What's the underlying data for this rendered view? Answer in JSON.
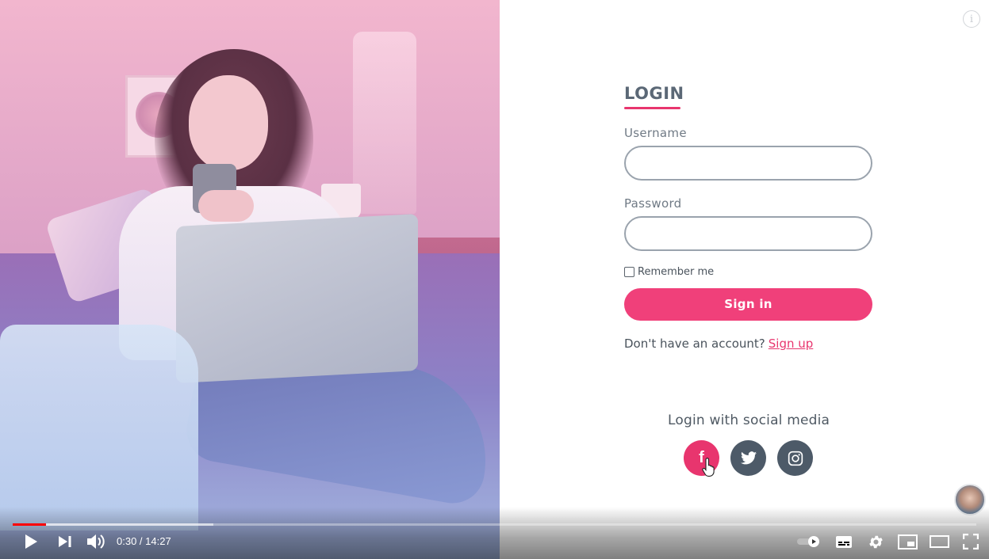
{
  "login": {
    "title": "LOGIN",
    "username_label": "Username",
    "username_value": "",
    "password_label": "Password",
    "password_value": "",
    "remember_label": "Remember me",
    "remember_checked": false,
    "signin_label": "Sign in",
    "no_account_text": "Don't have an account?",
    "signup_label": "Sign up",
    "accent_color": "#e8356e"
  },
  "social": {
    "title": "Login with social media",
    "buttons": [
      {
        "icon": "facebook-icon",
        "glyph": "f",
        "color": "#e8356e"
      },
      {
        "icon": "twitter-icon",
        "color": "#4d5a68"
      },
      {
        "icon": "instagram-icon",
        "color": "#4d5a68"
      }
    ]
  },
  "overlay": {
    "info_glyph": "i",
    "channel_avatar_icon": "channel-avatar-icon"
  },
  "player": {
    "current_time": "0:30",
    "duration": "14:27",
    "time_display": "0:30 / 14:27",
    "played_fraction": 0.0346,
    "buffered_fraction": 0.208,
    "progress_color": "#ff0000",
    "icons": [
      "play-icon",
      "next-icon",
      "volume-icon",
      "autoplay-toggle-icon",
      "subtitles-icon",
      "settings-icon",
      "miniplayer-icon",
      "theater-mode-icon",
      "fullscreen-icon"
    ]
  }
}
